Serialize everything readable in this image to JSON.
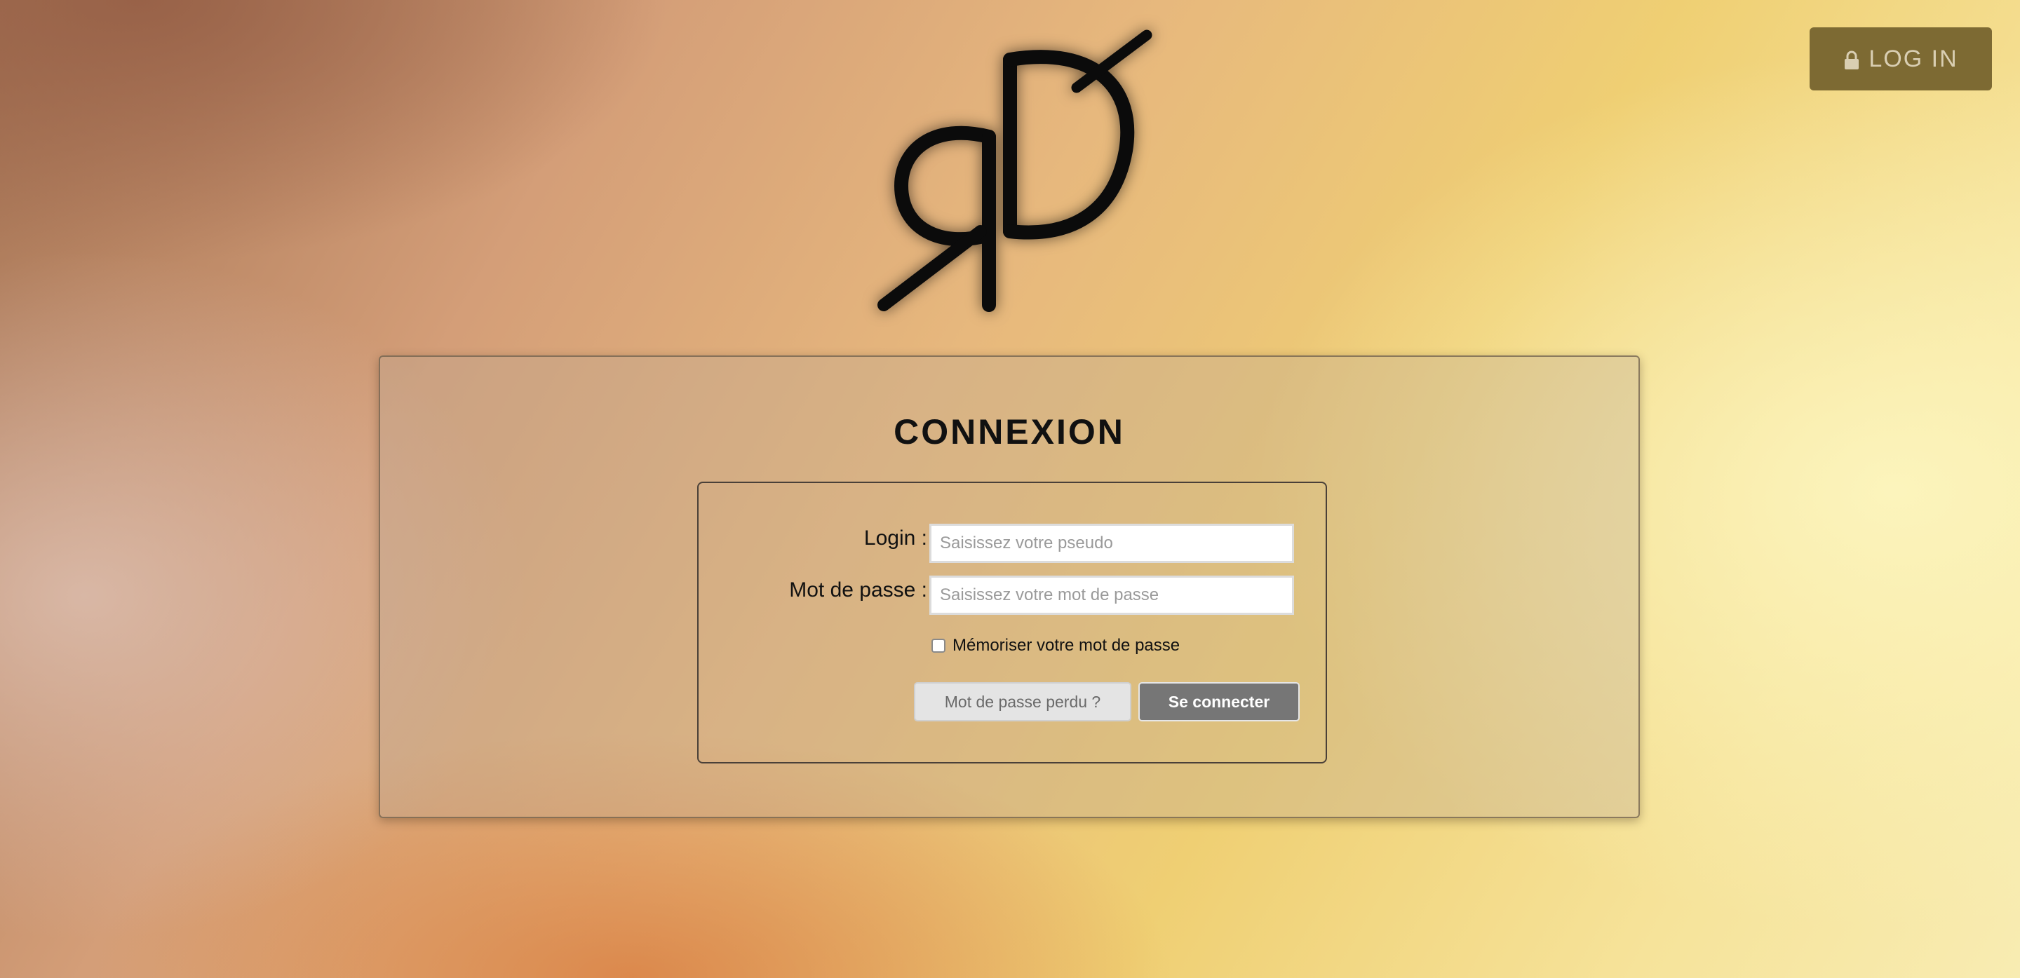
{
  "header": {
    "login_button_label": "LOG IN",
    "login_button_icon": "lock-icon"
  },
  "logo": {
    "text": "RD"
  },
  "login_panel": {
    "title": "CONNEXION",
    "login_label": "Login :",
    "login_placeholder": "Saisissez votre pseudo",
    "login_value": "",
    "password_label": "Mot de passe :",
    "password_placeholder": "Saisissez votre mot de passe",
    "password_value": "",
    "remember_label": "Mémoriser votre mot de passe",
    "remember_checked": false,
    "lost_password_label": "Mot de passe perdu ?",
    "submit_label": "Se connecter"
  },
  "colors": {
    "login_button_bg": "#7d6a33",
    "submit_bg": "#767676",
    "lost_password_bg": "#e4e4e4"
  }
}
